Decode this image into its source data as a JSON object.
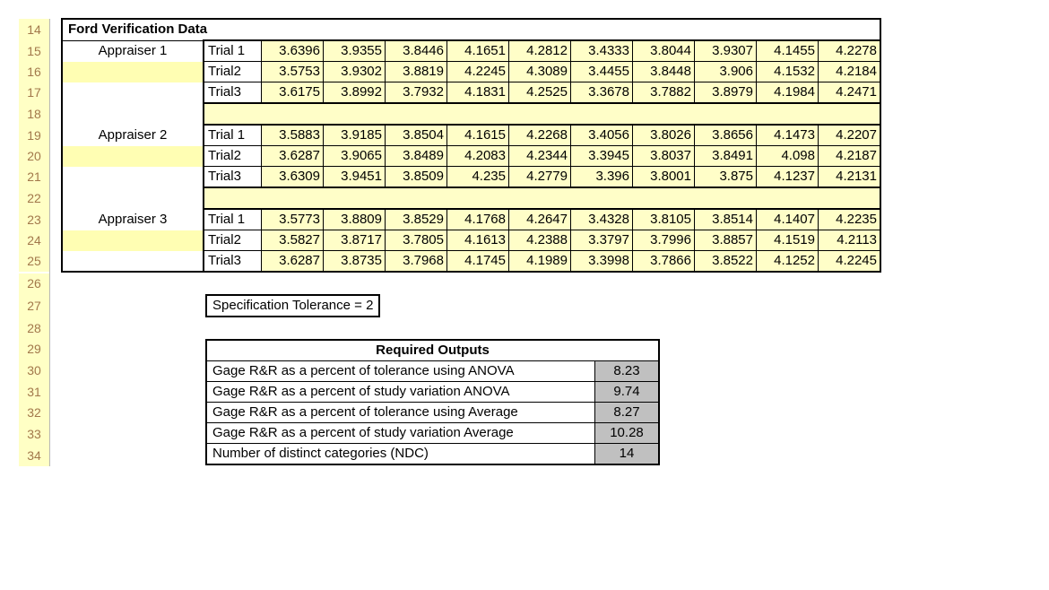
{
  "title": "Ford Verification Data",
  "spec_text": "Specification Tolerance = 2",
  "row_numbers": [
    14,
    15,
    16,
    17,
    18,
    19,
    20,
    21,
    22,
    23,
    24,
    25,
    26,
    27,
    28,
    29,
    30,
    31,
    32,
    33,
    34
  ],
  "appraisers": [
    {
      "name": "Appraiser 1",
      "trials": [
        {
          "label": "Trial 1",
          "values": [
            3.6396,
            3.9355,
            3.8446,
            4.1651,
            4.2812,
            3.4333,
            3.8044,
            3.9307,
            4.1455,
            4.2278
          ]
        },
        {
          "label": "Trial2",
          "values": [
            3.5753,
            3.9302,
            3.8819,
            4.2245,
            4.3089,
            3.4455,
            3.8448,
            3.906,
            4.1532,
            4.2184
          ]
        },
        {
          "label": "Trial3",
          "values": [
            3.6175,
            3.8992,
            3.7932,
            4.1831,
            4.2525,
            3.3678,
            3.7882,
            3.8979,
            4.1984,
            4.2471
          ]
        }
      ]
    },
    {
      "name": "Appraiser 2",
      "trials": [
        {
          "label": "Trial 1",
          "values": [
            3.5883,
            3.9185,
            3.8504,
            4.1615,
            4.2268,
            3.4056,
            3.8026,
            3.8656,
            4.1473,
            4.2207
          ]
        },
        {
          "label": "Trial2",
          "values": [
            3.6287,
            3.9065,
            3.8489,
            4.2083,
            4.2344,
            3.3945,
            3.8037,
            3.8491,
            4.098,
            4.2187
          ]
        },
        {
          "label": "Trial3",
          "values": [
            3.6309,
            3.9451,
            3.8509,
            4.235,
            4.2779,
            3.396,
            3.8001,
            3.875,
            4.1237,
            4.2131
          ]
        }
      ]
    },
    {
      "name": "Appraiser 3",
      "trials": [
        {
          "label": "Trial 1",
          "values": [
            3.5773,
            3.8809,
            3.8529,
            4.1768,
            4.2647,
            3.4328,
            3.8105,
            3.8514,
            4.1407,
            4.2235
          ]
        },
        {
          "label": "Trial2",
          "values": [
            3.5827,
            3.8717,
            3.7805,
            4.1613,
            4.2388,
            3.3797,
            3.7996,
            3.8857,
            4.1519,
            4.2113
          ]
        },
        {
          "label": "Trial3",
          "values": [
            3.6287,
            3.8735,
            3.7968,
            4.1745,
            4.1989,
            3.3998,
            3.7866,
            3.8522,
            4.1252,
            4.2245
          ]
        }
      ]
    }
  ],
  "outputs": {
    "header": "Required Outputs",
    "rows": [
      {
        "label": "Gage R&R as a percent of tolerance using ANOVA",
        "value": "8.23"
      },
      {
        "label": "Gage R&R as a percent of study variation ANOVA",
        "value": "9.74"
      },
      {
        "label": "Gage R&R as a percent of tolerance using Average",
        "value": "8.27"
      },
      {
        "label": "Gage R&R as a percent of study variation  Average",
        "value": "10.28"
      },
      {
        "label": "Number of distinct categories (NDC)",
        "value": "14"
      }
    ]
  }
}
